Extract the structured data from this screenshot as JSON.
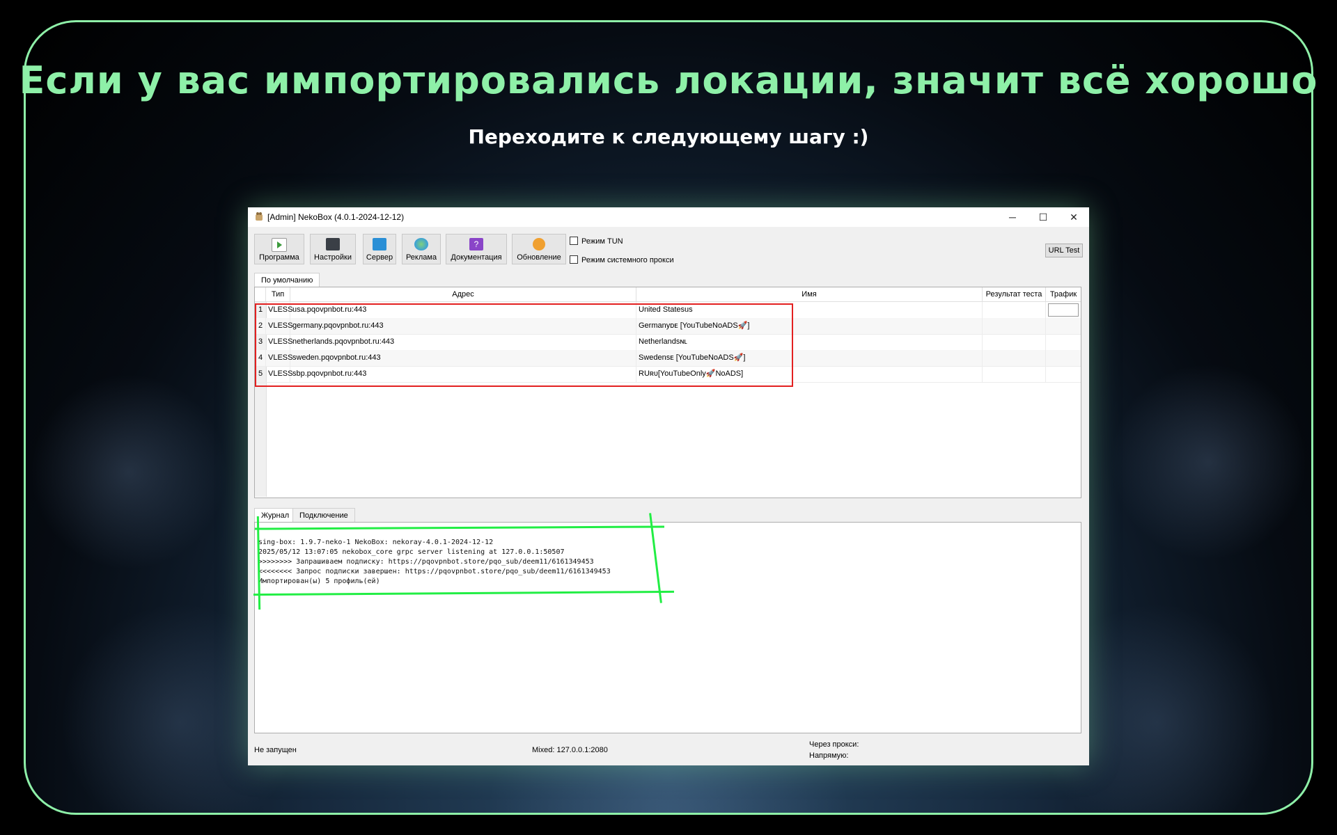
{
  "headline": "Если у вас импортировались локации, значит всё хорошо",
  "subline": "Переходите к следующему шагу :)",
  "window": {
    "title": "[Admin] NekoBox (4.0.1-2024-12-12)",
    "controls": {
      "minimize": "─",
      "maximize": "☐",
      "close": "✕"
    }
  },
  "toolbar": {
    "buttons": [
      {
        "label": "Программа",
        "icon": "play-icon",
        "color": "#3c9b3c"
      },
      {
        "label": "Настройки",
        "icon": "settings-icon",
        "color": "#3a3f46"
      },
      {
        "label": "Сервер",
        "icon": "server-icon",
        "color": "#2a8fd6"
      },
      {
        "label": "Реклама",
        "icon": "globe-icon",
        "color": "#3aa0d8"
      },
      {
        "label": "Документация",
        "icon": "help-icon",
        "color": "#8a45c8"
      },
      {
        "label": "Обновление",
        "icon": "update-icon",
        "color": "#f0a030"
      }
    ],
    "tun_mode": "Режим TUN",
    "system_proxy": "Режим системного прокси",
    "url_test": "URL Test"
  },
  "group_tab": "По умолчанию",
  "table": {
    "headers": [
      "Тип",
      "Адрес",
      "Имя",
      "Результат теста",
      "Трафик"
    ],
    "rows": [
      {
        "num": "1",
        "type": "VLESS",
        "address": "usa.pqovpnbot.ru:443",
        "name": "United Statesus"
      },
      {
        "num": "2",
        "type": "VLESS",
        "address": "germany.pqovpnbot.ru:443",
        "name": "Germanyᴅᴇ [YouTubeNoADS🚀]"
      },
      {
        "num": "3",
        "type": "VLESS",
        "address": "netherlands.pqovpnbot.ru:443",
        "name": "Netherlandsɴʟ"
      },
      {
        "num": "4",
        "type": "VLESS",
        "address": "sweden.pqovpnbot.ru:443",
        "name": "Swedenѕᴇ [YouTubeNoADS🚀]"
      },
      {
        "num": "5",
        "type": "VLESS",
        "address": "sbp.pqovpnbot.ru:443",
        "name": "RUʀᴜ[YouTubeOnly🚀NoADS]"
      }
    ]
  },
  "log_tabs": [
    "Журнал",
    "Подключение"
  ],
  "log_lines": [
    "sing-box: 1.9.7-neko-1 NekoBox: nekoray-4.0.1-2024-12-12",
    "2025/05/12 13:07:05 nekobox_core grpc server listening at 127.0.0.1:50507",
    ">>>>>>>> Запрашиваем подписку: https://pqovpnbot.store/pqo_sub/deem11/6161349453",
    "<<<<<<<< Запрос подписки завершен: https://pqovpnbot.store/pqo_sub/deem11/6161349453",
    "Импортирован(ы) 5 профиль(ей)"
  ],
  "statusbar": {
    "state": "Не запущен",
    "mixed": "Mixed: 127.0.0.1:2080",
    "via_proxy": "Через прокси:",
    "direct": "Напрямую:"
  },
  "colors": {
    "accent": "#8ef0a8",
    "highlight_red": "#e32020",
    "highlight_green": "#22ee44"
  }
}
